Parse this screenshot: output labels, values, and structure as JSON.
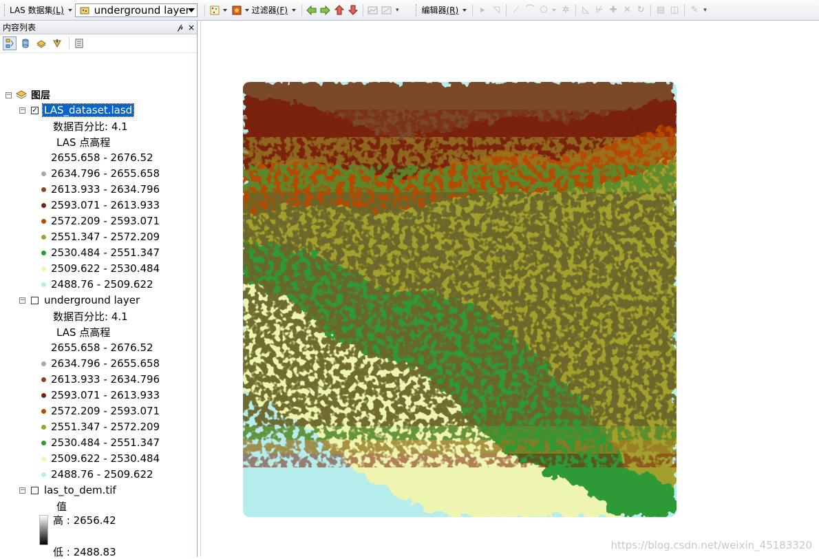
{
  "toolbar": {
    "las_label": "LAS 数据集",
    "las_hotkey": "(L)",
    "layer_selector_value": "underground layer",
    "filter_label": "过滤器",
    "filter_hotkey": "(F)",
    "editor_label": "编辑器",
    "editor_hotkey": "(R)"
  },
  "toc": {
    "title": "内容列表",
    "pin_glyph": "ᵽ",
    "close_glyph": "×",
    "root_label": "图层",
    "layers": [
      {
        "name": "LAS_dataset.lasd",
        "checked": true,
        "selected": true,
        "percent_label": "数据百分比: 4.1",
        "renderer_label": "LAS 点高程",
        "classes": [
          {
            "label": "2655.658 - 2676.52",
            "color": "#ffffff"
          },
          {
            "label": "2634.796 - 2655.658",
            "color": "#a9a9ad"
          },
          {
            "label": "2613.933 - 2634.796",
            "color": "#7a4a2a"
          },
          {
            "label": "2593.071 - 2613.933",
            "color": "#7a2208"
          },
          {
            "label": "2572.209 - 2593.071",
            "color": "#b84a06"
          },
          {
            "label": "2551.347 - 2572.209",
            "color": "#a3a12e"
          },
          {
            "label": "2530.484 - 2551.347",
            "color": "#2e9a34"
          },
          {
            "label": "2509.622 - 2530.484",
            "color": "#eef5b0"
          },
          {
            "label": "2488.76 - 2509.622",
            "color": "#b5eded"
          }
        ]
      },
      {
        "name": "underground layer",
        "checked": false,
        "selected": false,
        "percent_label": "数据百分比: 4.1",
        "renderer_label": "LAS 点高程",
        "classes": [
          {
            "label": "2655.658 - 2676.52",
            "color": "#ffffff"
          },
          {
            "label": "2634.796 - 2655.658",
            "color": "#a9a9ad"
          },
          {
            "label": "2613.933 - 2634.796",
            "color": "#7a4a2a"
          },
          {
            "label": "2593.071 - 2613.933",
            "color": "#7a2208"
          },
          {
            "label": "2572.209 - 2593.071",
            "color": "#b84a06"
          },
          {
            "label": "2551.347 - 2572.209",
            "color": "#a3a12e"
          },
          {
            "label": "2530.484 - 2551.347",
            "color": "#2e9a34"
          },
          {
            "label": "2509.622 - 2530.484",
            "color": "#eef5b0"
          },
          {
            "label": "2488.76 - 2509.622",
            "color": "#b5eded"
          }
        ]
      },
      {
        "name": "las_to_dem.tif",
        "checked": false,
        "selected": false,
        "value_label": "值",
        "high_label": "高 : 2656.42",
        "low_label": "低 : 2488.83"
      }
    ]
  },
  "map": {
    "band_colors": [
      "#a9a9ad",
      "#7a4a2a",
      "#7a2208",
      "#b84a06",
      "#a3a12e",
      "#2e9a34",
      "#eef5b0",
      "#b5eded"
    ]
  },
  "watermark": "https://blog.csdn.net/weixin_45183320"
}
